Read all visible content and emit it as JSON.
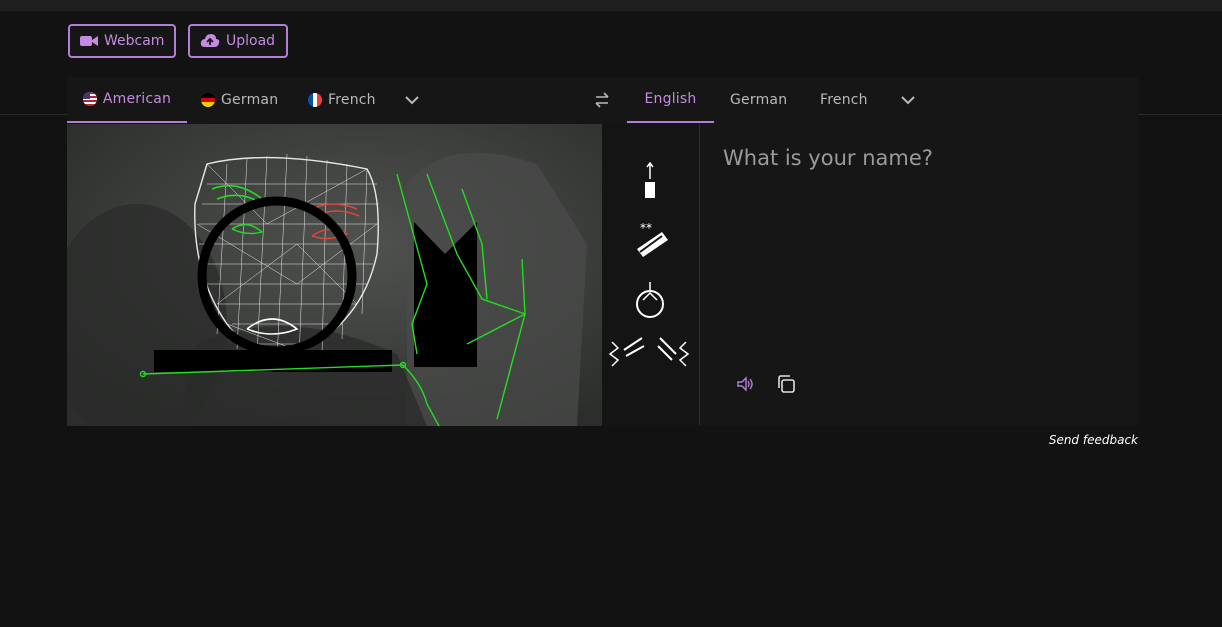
{
  "toolbar": {
    "webcam_label": "Webcam",
    "upload_label": "Upload",
    "webcam_icon": "video-camera-icon",
    "upload_icon": "cloud-upload-icon"
  },
  "source_languages": {
    "tabs": [
      {
        "label": "American",
        "flag": "us-flag-icon",
        "active": true
      },
      {
        "label": "German",
        "flag": "de-flag-icon",
        "active": false
      },
      {
        "label": "French",
        "flag": "fr-flag-icon",
        "active": false
      }
    ],
    "more_icon": "chevron-down-icon"
  },
  "swap_icon": "swap-arrows-icon",
  "target_languages": {
    "tabs": [
      {
        "label": "English",
        "active": true
      },
      {
        "label": "German",
        "active": false
      },
      {
        "label": "French",
        "active": false
      }
    ],
    "more_icon": "chevron-down-icon"
  },
  "output": {
    "text": "What is your name?",
    "speak_icon": "speaker-icon",
    "copy_icon": "copy-icon"
  },
  "footer": {
    "feedback_label": "Send feedback"
  },
  "colors": {
    "accent": "#b37fd6",
    "background": "#121212",
    "panel": "#161616",
    "pose_green": "#22dd22",
    "eye_red": "#e0463a"
  }
}
